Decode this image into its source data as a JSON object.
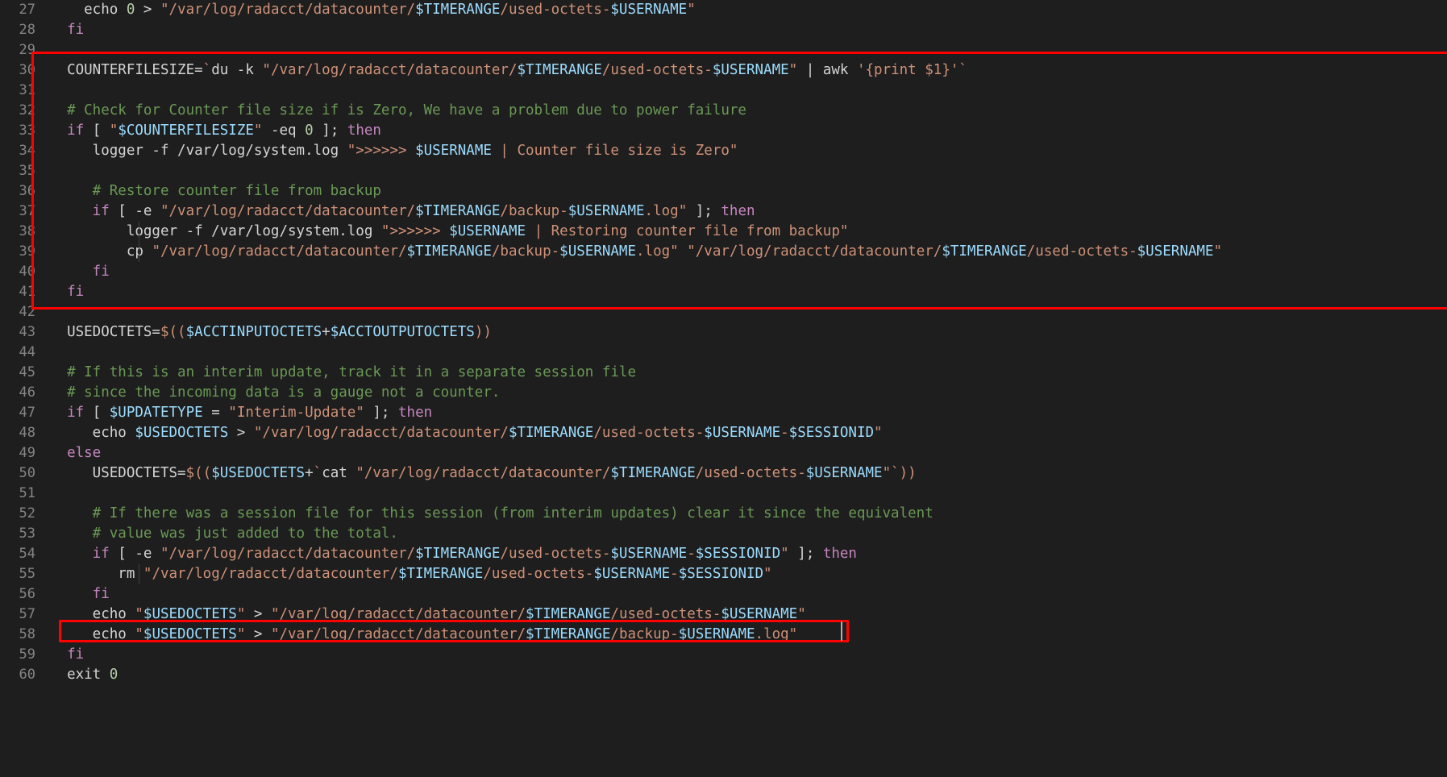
{
  "editor": {
    "theme": "dark-plus",
    "language": "shellscript",
    "background_color": "#1e1e1e",
    "gutter_color": "#858585",
    "caret_color": "#aeafad",
    "colors": {
      "keyword": "#c586c0",
      "string": "#ce9178",
      "variable": "#9cdcfe",
      "comment": "#6a9955",
      "plain": "#d4d4d4",
      "number": "#b5cea8",
      "annotation_red": "#fe0000",
      "indent_guide": "#404040"
    }
  },
  "annotations": [
    {
      "name": "block-highlight",
      "first_line": 30,
      "last_line": 41
    },
    {
      "name": "line-highlight",
      "line": 58
    }
  ],
  "caret": {
    "line": 58,
    "after_text": "echo \"$USEDOCTETS\" > \"/var/log/radacct/datacounter/$TIMERANGE/backup-$USERNAME.log\""
  },
  "lines": [
    {
      "n": "27",
      "indent": 0,
      "guides": [],
      "tokens": [
        {
          "t": "plain",
          "v": "    echo "
        },
        {
          "t": "num",
          "v": "0"
        },
        {
          "t": "plain",
          "v": " > "
        },
        {
          "t": "str",
          "v": "\"/var/log/radacct/datacounter/"
        },
        {
          "t": "var",
          "v": "$TIMERANGE"
        },
        {
          "t": "str",
          "v": "/used-octets-"
        },
        {
          "t": "var",
          "v": "$USERNAME"
        },
        {
          "t": "str",
          "v": "\""
        }
      ]
    },
    {
      "n": "28",
      "indent": 0,
      "guides": [],
      "tokens": [
        {
          "t": "kw",
          "v": "  fi"
        }
      ]
    },
    {
      "n": "29",
      "indent": 0,
      "guides": [],
      "tokens": [
        {
          "t": "plain",
          "v": ""
        }
      ]
    },
    {
      "n": "30",
      "indent": 0,
      "guides": [],
      "tokens": [
        {
          "t": "plain",
          "v": "  COUNTERFILESIZE="
        },
        {
          "t": "str",
          "v": "`"
        },
        {
          "t": "plain",
          "v": "du -k "
        },
        {
          "t": "str",
          "v": "\"/var/log/radacct/datacounter/"
        },
        {
          "t": "var",
          "v": "$TIMERANGE"
        },
        {
          "t": "str",
          "v": "/used-octets-"
        },
        {
          "t": "var",
          "v": "$USERNAME"
        },
        {
          "t": "str",
          "v": "\""
        },
        {
          "t": "plain",
          "v": " | awk "
        },
        {
          "t": "str",
          "v": "'{print $1}'`"
        }
      ]
    },
    {
      "n": "31",
      "indent": 0,
      "guides": [],
      "tokens": [
        {
          "t": "plain",
          "v": ""
        }
      ]
    },
    {
      "n": "32",
      "indent": 0,
      "guides": [],
      "tokens": [
        {
          "t": "cmt",
          "v": "  # Check for Counter file size if is Zero, We have a problem due to power failure"
        }
      ]
    },
    {
      "n": "33",
      "indent": 0,
      "guides": [],
      "tokens": [
        {
          "t": "kw",
          "v": "  if"
        },
        {
          "t": "plain",
          "v": " [ "
        },
        {
          "t": "str",
          "v": "\""
        },
        {
          "t": "var",
          "v": "$COUNTERFILESIZE"
        },
        {
          "t": "str",
          "v": "\""
        },
        {
          "t": "plain",
          "v": " -eq "
        },
        {
          "t": "num",
          "v": "0"
        },
        {
          "t": "plain",
          "v": " ]; "
        },
        {
          "t": "kw",
          "v": "then"
        }
      ]
    },
    {
      "n": "34",
      "indent": 0,
      "guides": [],
      "tokens": [
        {
          "t": "plain",
          "v": "     logger -f /var/log/system.log "
        },
        {
          "t": "str",
          "v": "\">>>>>> "
        },
        {
          "t": "var",
          "v": "$USERNAME"
        },
        {
          "t": "str",
          "v": " | Counter file size is Zero\""
        }
      ]
    },
    {
      "n": "35",
      "indent": 0,
      "guides": [],
      "tokens": [
        {
          "t": "plain",
          "v": ""
        }
      ]
    },
    {
      "n": "36",
      "indent": 0,
      "guides": [],
      "tokens": [
        {
          "t": "cmt",
          "v": "     # Restore counter file from backup"
        }
      ]
    },
    {
      "n": "37",
      "indent": 0,
      "guides": [],
      "tokens": [
        {
          "t": "kw",
          "v": "     if"
        },
        {
          "t": "plain",
          "v": " [ -e "
        },
        {
          "t": "str",
          "v": "\"/var/log/radacct/datacounter/"
        },
        {
          "t": "var",
          "v": "$TIMERANGE"
        },
        {
          "t": "str",
          "v": "/backup-"
        },
        {
          "t": "var",
          "v": "$USERNAME"
        },
        {
          "t": "str",
          "v": ".log\""
        },
        {
          "t": "plain",
          "v": " ]; "
        },
        {
          "t": "kw",
          "v": "then"
        }
      ]
    },
    {
      "n": "38",
      "indent": 0,
      "guides": [
        128
      ],
      "tokens": [
        {
          "t": "plain",
          "v": "         logger -f /var/log/system.log "
        },
        {
          "t": "str",
          "v": "\">>>>>> "
        },
        {
          "t": "var",
          "v": "$USERNAME"
        },
        {
          "t": "str",
          "v": " | Restoring counter file from backup\""
        }
      ]
    },
    {
      "n": "39",
      "indent": 0,
      "guides": [
        128
      ],
      "tokens": [
        {
          "t": "plain",
          "v": "         cp "
        },
        {
          "t": "str",
          "v": "\"/var/log/radacct/datacounter/"
        },
        {
          "t": "var",
          "v": "$TIMERANGE"
        },
        {
          "t": "str",
          "v": "/backup-"
        },
        {
          "t": "var",
          "v": "$USERNAME"
        },
        {
          "t": "str",
          "v": ".log\""
        },
        {
          "t": "plain",
          "v": " "
        },
        {
          "t": "str",
          "v": "\"/var/log/radacct/datacounter/"
        },
        {
          "t": "var",
          "v": "$TIMERANGE"
        },
        {
          "t": "str",
          "v": "/used-octets-"
        },
        {
          "t": "var",
          "v": "$USERNAME"
        },
        {
          "t": "str",
          "v": "\""
        }
      ]
    },
    {
      "n": "40",
      "indent": 0,
      "guides": [],
      "tokens": [
        {
          "t": "kw",
          "v": "     fi"
        }
      ]
    },
    {
      "n": "41",
      "indent": 0,
      "guides": [],
      "tokens": [
        {
          "t": "kw",
          "v": "  fi"
        }
      ]
    },
    {
      "n": "42",
      "indent": 0,
      "guides": [],
      "tokens": [
        {
          "t": "plain",
          "v": ""
        }
      ]
    },
    {
      "n": "43",
      "indent": 0,
      "guides": [],
      "tokens": [
        {
          "t": "plain",
          "v": "  USEDOCTETS="
        },
        {
          "t": "str",
          "v": "$(("
        },
        {
          "t": "var",
          "v": "$ACCTINPUTOCTETS"
        },
        {
          "t": "plain",
          "v": "+"
        },
        {
          "t": "var",
          "v": "$ACCTOUTPUTOCTETS"
        },
        {
          "t": "str",
          "v": "))"
        }
      ]
    },
    {
      "n": "44",
      "indent": 0,
      "guides": [],
      "tokens": [
        {
          "t": "plain",
          "v": ""
        }
      ]
    },
    {
      "n": "45",
      "indent": 0,
      "guides": [],
      "tokens": [
        {
          "t": "cmt",
          "v": "  # If this is an interim update, track it in a separate session file"
        }
      ]
    },
    {
      "n": "46",
      "indent": 0,
      "guides": [],
      "tokens": [
        {
          "t": "cmt",
          "v": "  # since the incoming data is a gauge not a counter."
        }
      ]
    },
    {
      "n": "47",
      "indent": 0,
      "guides": [],
      "tokens": [
        {
          "t": "kw",
          "v": "  if"
        },
        {
          "t": "plain",
          "v": " [ "
        },
        {
          "t": "var",
          "v": "$UPDATETYPE"
        },
        {
          "t": "plain",
          "v": " = "
        },
        {
          "t": "str",
          "v": "\"Interim-Update\""
        },
        {
          "t": "plain",
          "v": " ]; "
        },
        {
          "t": "kw",
          "v": "then"
        }
      ]
    },
    {
      "n": "48",
      "indent": 0,
      "guides": [],
      "tokens": [
        {
          "t": "plain",
          "v": "     echo "
        },
        {
          "t": "var",
          "v": "$USEDOCTETS"
        },
        {
          "t": "plain",
          "v": " > "
        },
        {
          "t": "str",
          "v": "\"/var/log/radacct/datacounter/"
        },
        {
          "t": "var",
          "v": "$TIMERANGE"
        },
        {
          "t": "str",
          "v": "/used-octets-"
        },
        {
          "t": "var",
          "v": "$USERNAME"
        },
        {
          "t": "str",
          "v": "-"
        },
        {
          "t": "var",
          "v": "$SESSIONID"
        },
        {
          "t": "str",
          "v": "\""
        }
      ]
    },
    {
      "n": "49",
      "indent": 0,
      "guides": [],
      "tokens": [
        {
          "t": "kw",
          "v": "  else"
        }
      ]
    },
    {
      "n": "50",
      "indent": 0,
      "guides": [],
      "tokens": [
        {
          "t": "plain",
          "v": "     USEDOCTETS="
        },
        {
          "t": "str",
          "v": "$(("
        },
        {
          "t": "var",
          "v": "$USEDOCTETS"
        },
        {
          "t": "plain",
          "v": "+"
        },
        {
          "t": "str",
          "v": "`"
        },
        {
          "t": "plain",
          "v": "cat "
        },
        {
          "t": "str",
          "v": "\"/var/log/radacct/datacounter/"
        },
        {
          "t": "var",
          "v": "$TIMERANGE"
        },
        {
          "t": "str",
          "v": "/used-octets-"
        },
        {
          "t": "var",
          "v": "$USERNAME"
        },
        {
          "t": "str",
          "v": "\"`))"
        }
      ]
    },
    {
      "n": "51",
      "indent": 0,
      "guides": [],
      "tokens": [
        {
          "t": "plain",
          "v": ""
        }
      ]
    },
    {
      "n": "52",
      "indent": 0,
      "guides": [],
      "tokens": [
        {
          "t": "cmt",
          "v": "     # If there was a session file for this session (from interim updates) clear it since the equivalent"
        }
      ]
    },
    {
      "n": "53",
      "indent": 0,
      "guides": [],
      "tokens": [
        {
          "t": "cmt",
          "v": "     # value was just added to the total."
        }
      ]
    },
    {
      "n": "54",
      "indent": 0,
      "guides": [],
      "tokens": [
        {
          "t": "kw",
          "v": "     if"
        },
        {
          "t": "plain",
          "v": " [ -e "
        },
        {
          "t": "str",
          "v": "\"/var/log/radacct/datacounter/"
        },
        {
          "t": "var",
          "v": "$TIMERANGE"
        },
        {
          "t": "str",
          "v": "/used-octets-"
        },
        {
          "t": "var",
          "v": "$USERNAME"
        },
        {
          "t": "str",
          "v": "-"
        },
        {
          "t": "var",
          "v": "$SESSIONID"
        },
        {
          "t": "str",
          "v": "\""
        },
        {
          "t": "plain",
          "v": " ]; "
        },
        {
          "t": "kw",
          "v": "then"
        }
      ]
    },
    {
      "n": "55",
      "indent": 0,
      "guides": [
        128
      ],
      "tokens": [
        {
          "t": "plain",
          "v": "        rm "
        },
        {
          "t": "str",
          "v": "\"/var/log/radacct/datacounter/"
        },
        {
          "t": "var",
          "v": "$TIMERANGE"
        },
        {
          "t": "str",
          "v": "/used-octets-"
        },
        {
          "t": "var",
          "v": "$USERNAME"
        },
        {
          "t": "str",
          "v": "-"
        },
        {
          "t": "var",
          "v": "$SESSIONID"
        },
        {
          "t": "str",
          "v": "\""
        }
      ]
    },
    {
      "n": "56",
      "indent": 0,
      "guides": [],
      "tokens": [
        {
          "t": "kw",
          "v": "     fi"
        }
      ]
    },
    {
      "n": "57",
      "indent": 0,
      "guides": [],
      "tokens": [
        {
          "t": "plain",
          "v": "     echo "
        },
        {
          "t": "str",
          "v": "\""
        },
        {
          "t": "var",
          "v": "$USEDOCTETS"
        },
        {
          "t": "str",
          "v": "\""
        },
        {
          "t": "plain",
          "v": " > "
        },
        {
          "t": "str",
          "v": "\"/var/log/radacct/datacounter/"
        },
        {
          "t": "var",
          "v": "$TIMERANGE"
        },
        {
          "t": "str",
          "v": "/used-octets-"
        },
        {
          "t": "var",
          "v": "$USERNAME"
        },
        {
          "t": "str",
          "v": "\""
        }
      ]
    },
    {
      "n": "58",
      "indent": 0,
      "guides": [],
      "tokens": [
        {
          "t": "plain",
          "v": "     echo "
        },
        {
          "t": "str",
          "v": "\""
        },
        {
          "t": "var",
          "v": "$USEDOCTETS"
        },
        {
          "t": "str",
          "v": "\""
        },
        {
          "t": "plain",
          "v": " > "
        },
        {
          "t": "str",
          "v": "\"/var/log/radacct/datacounter/"
        },
        {
          "t": "var",
          "v": "$TIMERANGE"
        },
        {
          "t": "str",
          "v": "/backup-"
        },
        {
          "t": "var",
          "v": "$USERNAME"
        },
        {
          "t": "str",
          "v": ".log\""
        }
      ]
    },
    {
      "n": "59",
      "indent": 0,
      "guides": [],
      "tokens": [
        {
          "t": "kw",
          "v": "  fi"
        }
      ]
    },
    {
      "n": "60",
      "indent": 0,
      "guides": [],
      "tokens": [
        {
          "t": "plain",
          "v": "  exit "
        },
        {
          "t": "num",
          "v": "0"
        }
      ]
    }
  ]
}
